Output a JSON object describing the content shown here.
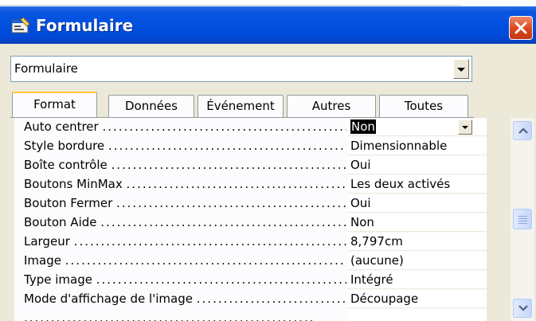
{
  "window": {
    "title": "Formulaire",
    "icon": "form-properties-icon",
    "close_icon": "close-icon"
  },
  "object_selector": {
    "value": "Formulaire",
    "icon": "chevron-down-icon"
  },
  "tabs": [
    {
      "label": "Format",
      "active": true
    },
    {
      "label": "Données",
      "active": false
    },
    {
      "label": "Événement",
      "active": false
    },
    {
      "label": "Autres",
      "active": false
    },
    {
      "label": "Toutes",
      "active": false
    }
  ],
  "properties": [
    {
      "label": "Auto centrer",
      "value": "Non",
      "selected": true,
      "dropdown": true
    },
    {
      "label": "Style bordure",
      "value": "Dimensionnable"
    },
    {
      "label": "Boîte contrôle",
      "value": "Oui"
    },
    {
      "label": "Boutons MinMax",
      "value": "Les deux activés"
    },
    {
      "label": "Bouton Fermer",
      "value": "Oui"
    },
    {
      "label": "Bouton Aide",
      "value": "Non"
    },
    {
      "label": "Largeur",
      "value": "8,797cm"
    },
    {
      "label": "Image",
      "value": "(aucune)"
    },
    {
      "label": "Type image",
      "value": "Intégré"
    },
    {
      "label": "Mode d'affichage de l'image",
      "value": "Découpage"
    }
  ],
  "colors": {
    "titlebar": "#0050e0",
    "close_button": "#d9461e",
    "dialog_face": "#ece9d8",
    "active_tab_highlight": "#ffc83c"
  }
}
